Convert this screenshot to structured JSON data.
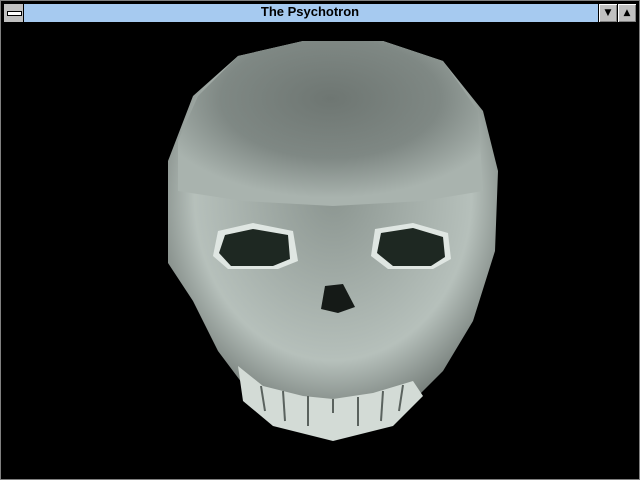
{
  "window": {
    "title": "The Psychotron"
  },
  "icons": {
    "system_menu": "system-menu-icon",
    "minimize": "minimize-arrow-icon",
    "maximize": "maximize-arrow-icon"
  },
  "colors": {
    "titlebar": "#a6caf0",
    "background": "#000000",
    "skull": "#8a9490"
  }
}
